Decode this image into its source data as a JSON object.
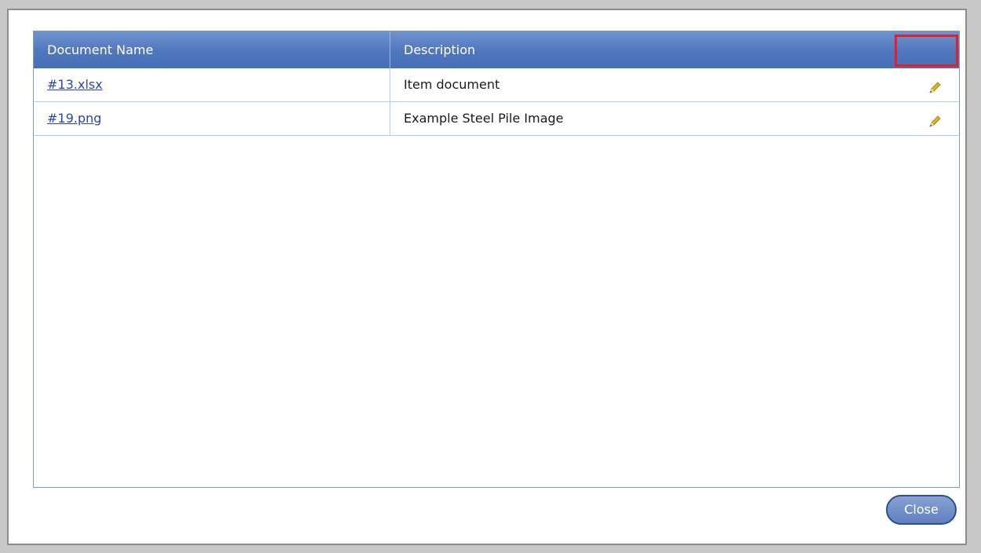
{
  "table": {
    "columns": [
      "Document Name",
      "Description"
    ],
    "rows": [
      {
        "name": "#13.xlsx",
        "description": "Item document",
        "edit_icon": "pencil-icon"
      },
      {
        "name": "#19.png",
        "description": "Example Steel Pile Image",
        "edit_icon": "pencil-icon"
      }
    ]
  },
  "footer": {
    "close_label": "Close"
  },
  "colors": {
    "header_blue": "#4f76bd",
    "link_blue": "#2a47a8",
    "highlight_red": "#e0202a",
    "pencil_yellow": "#e0b020"
  }
}
